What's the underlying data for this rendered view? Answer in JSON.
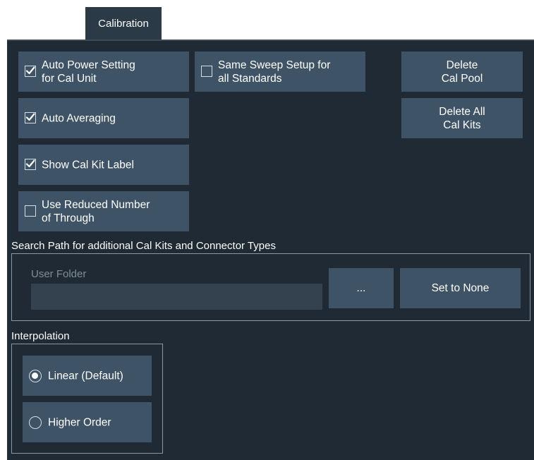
{
  "tab": {
    "label": "Calibration"
  },
  "options": {
    "auto_power": {
      "label": "Auto Power Setting\nfor Cal Unit",
      "checked": true
    },
    "same_sweep": {
      "label": "Same Sweep Setup for\nall Standards",
      "checked": false
    },
    "auto_averaging": {
      "label": "Auto Averaging",
      "checked": true
    },
    "show_cal_kit_label": {
      "label": "Show Cal Kit Label",
      "checked": true
    },
    "reduced_through": {
      "label": "Use Reduced Number\nof Through",
      "checked": false
    }
  },
  "buttons": {
    "delete_cal_pool": "Delete\nCal Pool",
    "delete_all_cal_kits": "Delete All\nCal Kits",
    "browse": "...",
    "set_to_none": "Set to None"
  },
  "search_path": {
    "title": "Search Path for additional Cal Kits and Connector Types",
    "user_folder_label": "User Folder",
    "user_folder_value": ""
  },
  "interpolation": {
    "title": "Interpolation",
    "options": [
      {
        "label": "Linear (Default)",
        "selected": true
      },
      {
        "label": "Higher Order",
        "selected": false
      }
    ]
  },
  "colors": {
    "panel_bg": "#1f2a34",
    "button_bg": "#3e5366",
    "tab_bg": "#2b3a47",
    "text": "#ffffff",
    "muted_text": "#7f8c97"
  }
}
